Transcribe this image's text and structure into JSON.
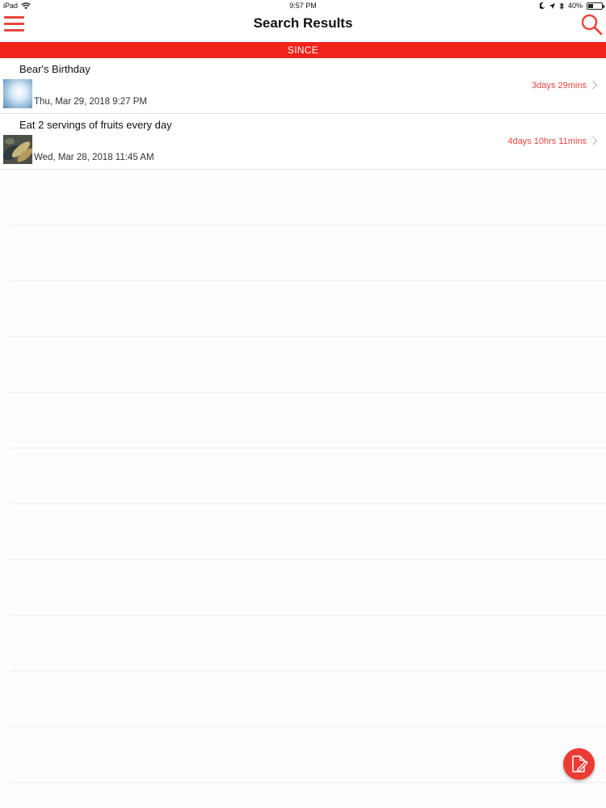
{
  "status_bar": {
    "device": "iPad",
    "time": "9:57 PM",
    "battery": "40%",
    "battery_level": 0.4
  },
  "nav": {
    "title": "Search Results",
    "menu_icon": "hamburger-menu-icon",
    "search_icon": "search-icon"
  },
  "section": {
    "label": "SINCE"
  },
  "items": [
    {
      "title": "Bear's Birthday",
      "date": "Thu, Mar 29, 2018 9:27 PM",
      "since": "3days 29mins",
      "thumb": "sky-photo"
    },
    {
      "title": "Eat 2 servings of fruits every day",
      "date": "Wed, Mar 28, 2018 11:45 AM",
      "since": "4days 10hrs 11mins",
      "thumb": "fruit-photo"
    }
  ],
  "fab": {
    "icon": "edit-document-icon"
  },
  "colors": {
    "accent": "#e8453c",
    "section_bg": "#f0241b"
  }
}
